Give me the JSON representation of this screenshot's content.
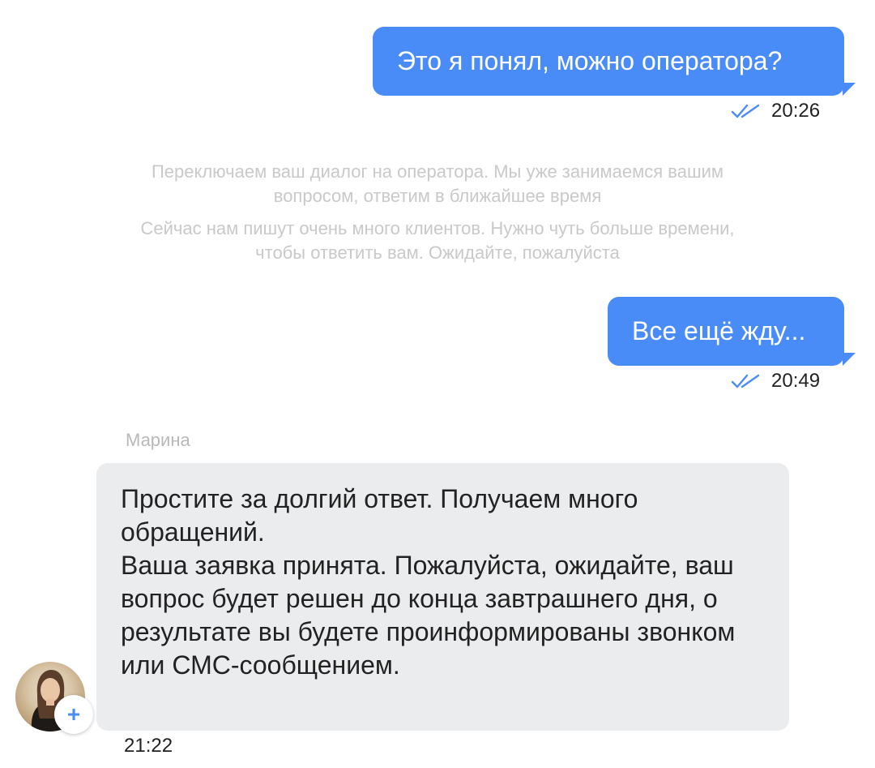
{
  "messages_out": [
    {
      "text": "Это я понял, можно оператора?",
      "time": "20:26"
    },
    {
      "text": "Все ещё жду...",
      "time": "20:49"
    }
  ],
  "system_messages": [
    "Переключаем ваш диалог на оператора. Мы уже занимаемся вашим\nвопросом, ответим в ближайшее время",
    "Сейчас нам пишут очень много клиентов. Нужно чуть больше времени,\nчтобы ответить вам. Ожидайте, пожалуйста"
  ],
  "incoming": {
    "sender": "Марина",
    "paragraph_1": "Простите за долгий ответ. Получаем много обращений.",
    "paragraph_2": "Ваша заявка принята. Пожалуйста, ожидайте, ваш вопрос будет решен до конца завтрашнего дня, о результате вы будете проинформированы звонком или СМС-сообщением.",
    "time": "21:22",
    "avatar_add_label": "+"
  },
  "icons": {
    "read_status": "double-check-icon",
    "avatar_add": "plus-icon"
  },
  "colors": {
    "outgoing_bubble": "#4a8cf7",
    "incoming_bubble": "#ebecee",
    "system_text": "#c9c9c9",
    "read_check": "#4a8cf7"
  }
}
